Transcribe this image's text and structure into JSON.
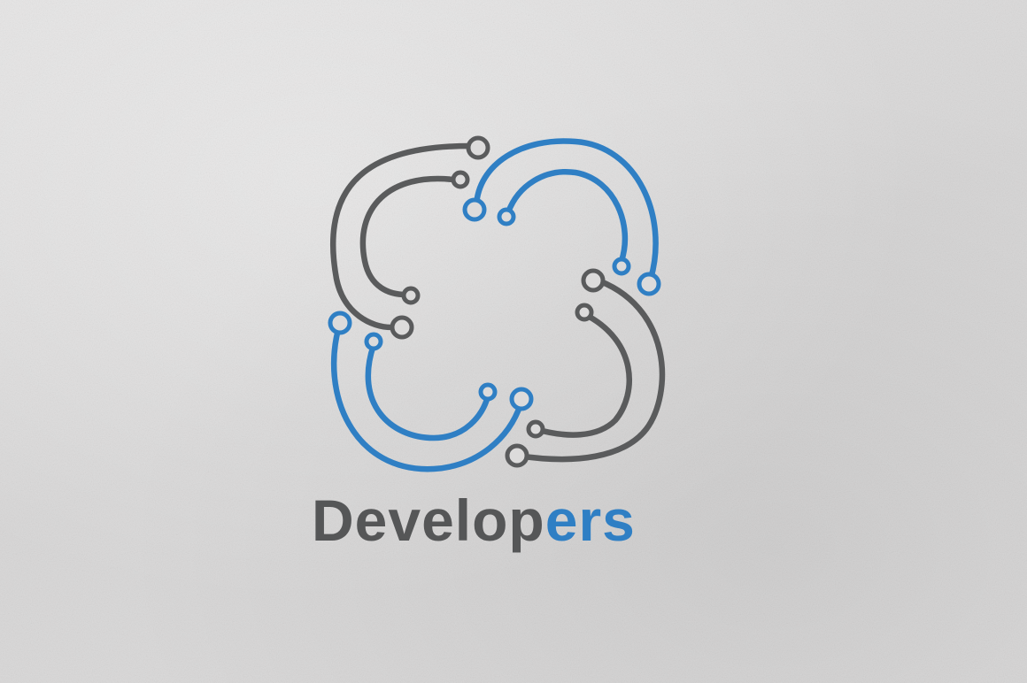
{
  "logo": {
    "wordmark_part1": "Develop",
    "wordmark_part2": "ers",
    "colors": {
      "gray": "#5a5b5c",
      "blue": "#2f7fc4",
      "background": "#d9d8d8"
    }
  }
}
